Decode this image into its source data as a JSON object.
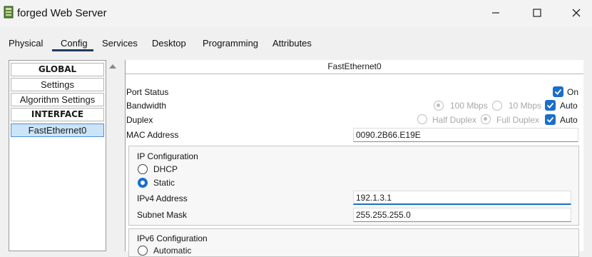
{
  "window": {
    "title": "forged Web Server"
  },
  "tabs": [
    {
      "label": "Physical"
    },
    {
      "label": "Config"
    },
    {
      "label": "Services"
    },
    {
      "label": "Desktop"
    },
    {
      "label": "Programming"
    },
    {
      "label": "Attributes"
    }
  ],
  "active_tab": "Config",
  "sidebar": {
    "items": [
      {
        "label": "GLOBAL"
      },
      {
        "label": "Settings"
      },
      {
        "label": "Algorithm Settings"
      },
      {
        "label": "INTERFACE"
      },
      {
        "label": "FastEthernet0"
      }
    ],
    "selected": "FastEthernet0"
  },
  "panel": {
    "header": "FastEthernet0",
    "port_status": {
      "label": "Port Status",
      "on_label": "On",
      "checked": true
    },
    "bandwidth": {
      "label": "Bandwidth",
      "opt1": "100 Mbps",
      "opt2": "10 Mbps",
      "auto_label": "Auto",
      "auto_checked": true
    },
    "duplex": {
      "label": "Duplex",
      "opt1": "Half Duplex",
      "opt2": "Full Duplex",
      "auto_label": "Auto",
      "auto_checked": true
    },
    "mac": {
      "label": "MAC Address",
      "value": "0090.2B66.E19E"
    },
    "ip_config": {
      "title": "IP Configuration",
      "dhcp_label": "DHCP",
      "static_label": "Static",
      "selected": "Static",
      "ipv4_label": "IPv4 Address",
      "ipv4_value": "192.1.3.1",
      "mask_label": "Subnet Mask",
      "mask_value": "255.255.255.0"
    },
    "ipv6_config": {
      "title": "IPv6 Configuration",
      "automatic_label": "Automatic"
    }
  },
  "colors": {
    "accent": "#1a6fc9",
    "tab_underline": "#1f3a5f",
    "selected_item_bg": "#cce4f7"
  }
}
